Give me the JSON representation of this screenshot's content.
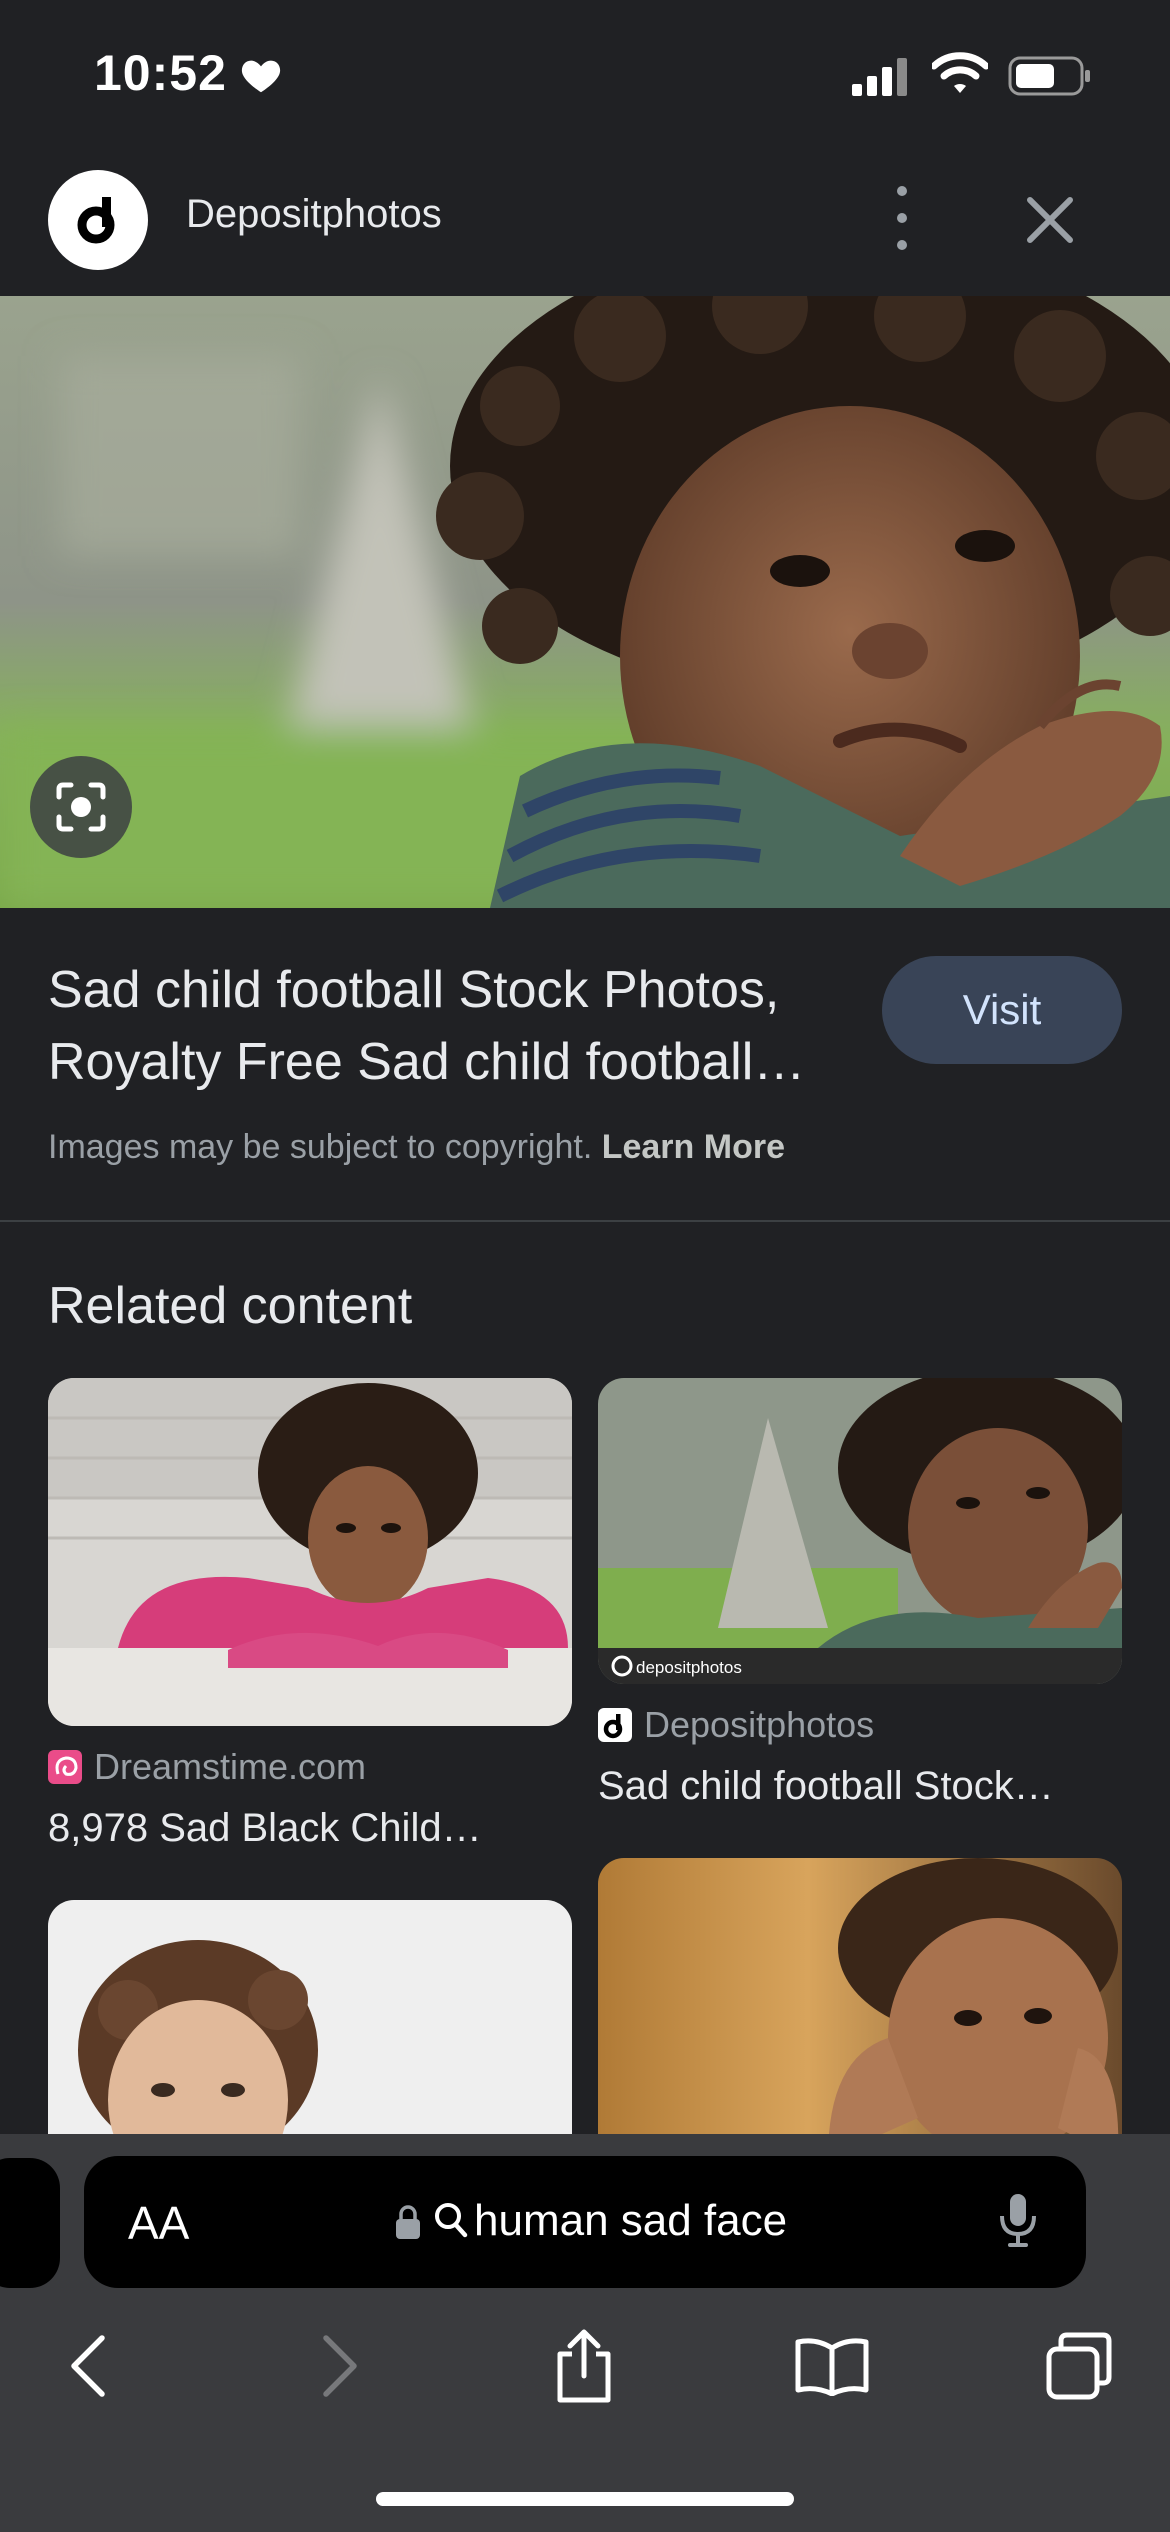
{
  "status_bar": {
    "time": "10:52"
  },
  "header": {
    "site_name": "Depositphotos"
  },
  "result": {
    "title_line1": "Sad child football Stock Photos,",
    "title_line2": "Royalty Free Sad child football…",
    "visit_label": "Visit",
    "copyright_text": "Images may be subject to copyright.",
    "learn_more": "Learn More"
  },
  "related": {
    "heading": "Related content",
    "cards": [
      {
        "source": "Dreamstime.com",
        "title": "8,978 Sad Black Child…"
      },
      {
        "source": "Depositphotos",
        "title": "Sad child football Stock…",
        "watermark": "depositphotos"
      }
    ]
  },
  "address_bar": {
    "aa_label": "AA",
    "query": "human sad face"
  },
  "colors": {
    "background": "#202124",
    "visit_button": "#394457",
    "toolbar": "#3a3b3e"
  }
}
